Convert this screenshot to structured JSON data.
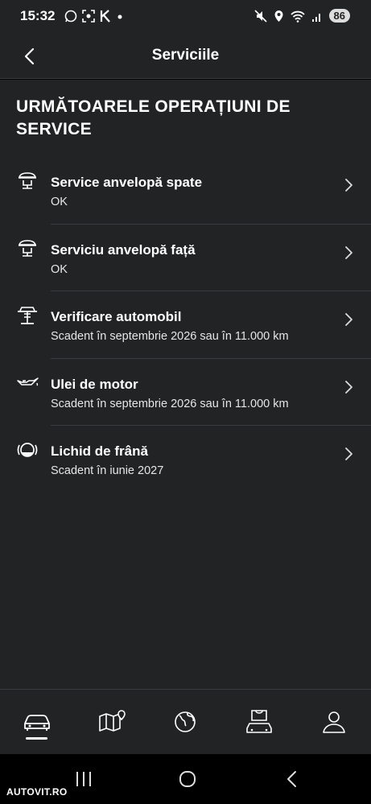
{
  "status_bar": {
    "time": "15:32",
    "battery": "86"
  },
  "header": {
    "title": "Serviciile"
  },
  "section": {
    "title": "URMĂTOARELE OPERAȚIUNI DE SERVICE"
  },
  "services": [
    {
      "name": "Service anvelopă spate",
      "status": "OK",
      "icon": "tire-service-icon"
    },
    {
      "name": "Serviciu anvelopă față",
      "status": "OK",
      "icon": "tire-service-icon"
    },
    {
      "name": "Verificare automobil",
      "status": "Scadent în septembrie 2026 sau în 11.000 km",
      "icon": "car-lift-icon"
    },
    {
      "name": "Ulei de motor",
      "status": "Scadent în septembrie 2026 sau în 11.000 km",
      "icon": "oil-can-icon"
    },
    {
      "name": "Lichid de frână",
      "status": "Scadent în iunie 2027",
      "icon": "brake-fluid-icon"
    }
  ],
  "bottom_nav": [
    "car-icon",
    "map-pin-icon",
    "globe-icon",
    "shop-car-icon",
    "profile-icon"
  ],
  "watermark": "AUTOVIT.RO",
  "colors": {
    "background": "#222325",
    "divider": "#3a3b3e",
    "text": "#ffffff"
  }
}
